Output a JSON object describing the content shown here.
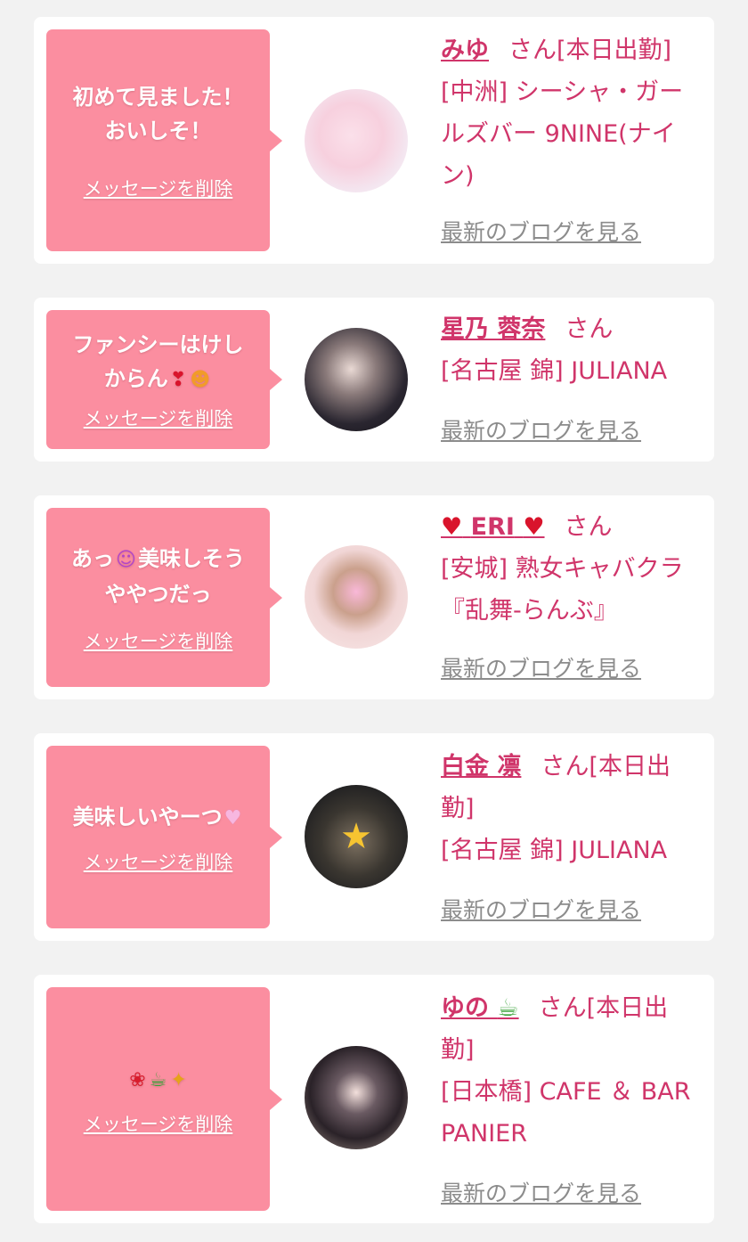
{
  "delete_label": "メッセージを削除",
  "blog_label": "最新のブログを見る",
  "san_label": "さん",
  "colors": {
    "page_background": "#f2f2f2",
    "card_background": "#ffffff",
    "bubble": "#fb8ea0",
    "accent_text": "#d0356a",
    "link_gray": "#8c8c8c"
  },
  "cards": [
    {
      "message_line1": "初めて見ました！",
      "message_line2": "おいしそ！",
      "name": "みゆ",
      "status": "[本日出勤]",
      "area": "[中洲]",
      "shop": "シーシャ・ガールズバー 9NINE(ナイン)"
    },
    {
      "message_line1": "ファンシーはけし",
      "message_line2": "からん",
      "emoji": [
        "heart-exclamation-icon",
        "kiss-face-icon"
      ],
      "name": "星乃 蓉奈",
      "status": "",
      "area": "[名古屋 錦]",
      "shop": "JULIANA"
    },
    {
      "message_line1": "あっ",
      "message_line1b": "美味しそう",
      "message_line2": "ややつだっ",
      "emoji": [
        "smiling-devil-icon"
      ],
      "name_prefix_icon": "red-heart-icon",
      "name": "ERI",
      "name_suffix_icon": "red-heart-icon",
      "status": "",
      "area": "[安城]",
      "shop": "熟女キャバクラ『乱舞-らんぶ』"
    },
    {
      "message_line1": "美味しいやーつ",
      "emoji": [
        "pink-heart-icon"
      ],
      "name": "白金 凛",
      "status": "[本日出勤]",
      "area": "[名古屋 錦]",
      "shop": "JULIANA"
    },
    {
      "emoji": [
        "ribbon-icon",
        "bubble-tea-icon",
        "sparkles-icon"
      ],
      "name": "ゆの",
      "name_suffix_icon": "bubble-tea-icon",
      "status": "[本日出勤]",
      "area": "[日本橋]",
      "shop": "CAFE ＆ BAR PANIER"
    }
  ]
}
